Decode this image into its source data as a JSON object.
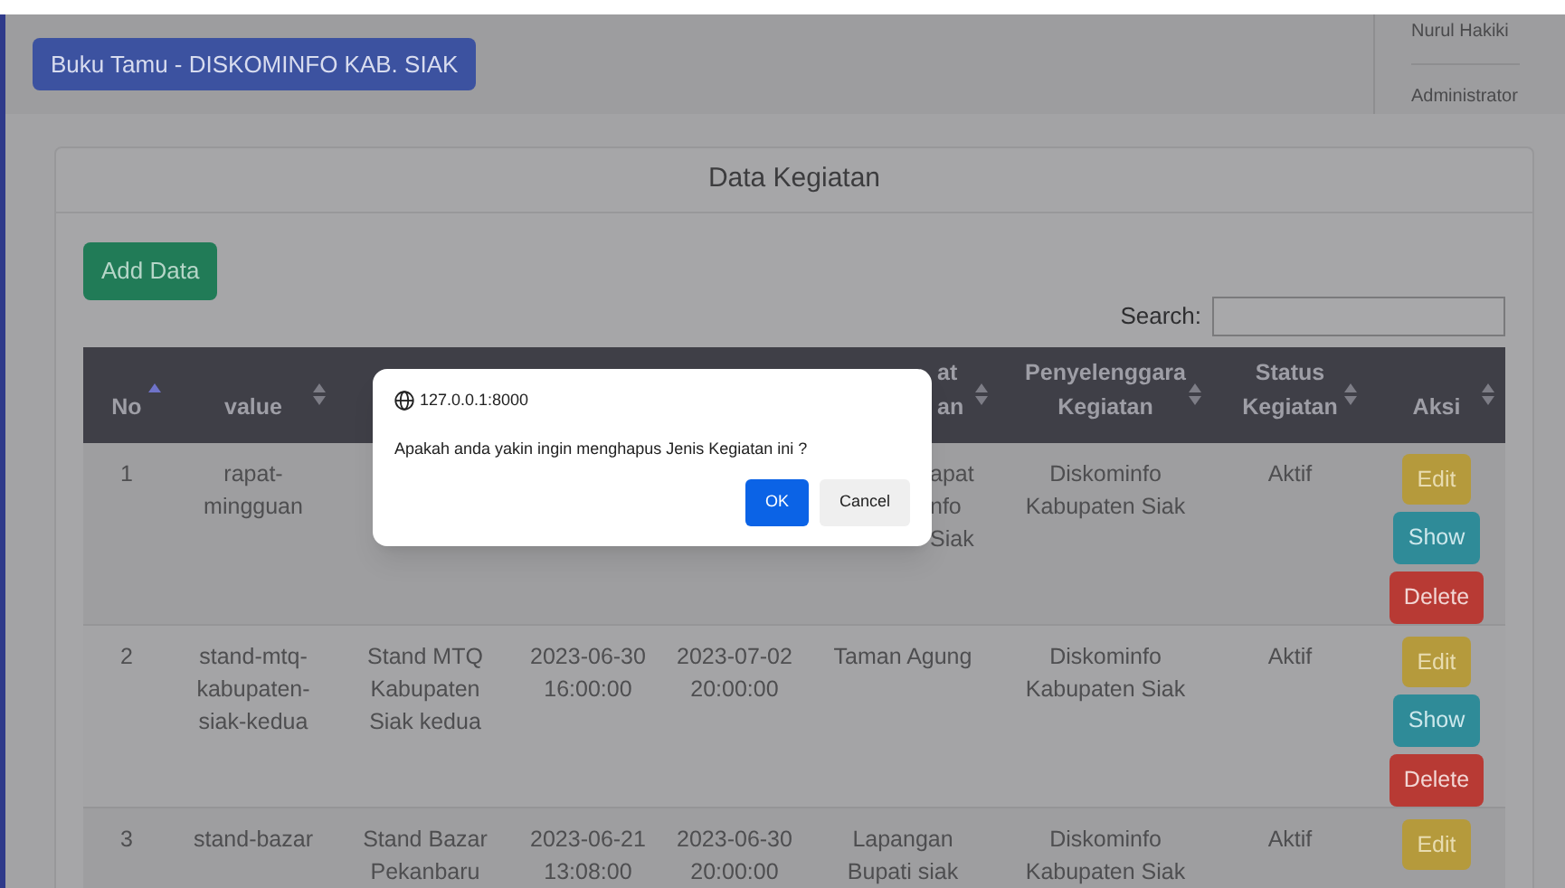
{
  "navbar": {
    "brand": "Buku Tamu - DISKOMINFO KAB. SIAK",
    "user_name": "Nurul Hakiki",
    "user_role": "Administrator"
  },
  "card": {
    "title": "Data Kegiatan",
    "add_button": "Add Data",
    "search_label": "Search:"
  },
  "table": {
    "columns": [
      {
        "label": "No",
        "sorted": true
      },
      {
        "label": "value",
        "sorted": false
      },
      {},
      {},
      {},
      {
        "label": "at an",
        "sorted": false
      },
      {
        "label": "Penyelenggara Kegiatan",
        "sorted": false
      },
      {
        "label": "Status Kegiatan",
        "sorted": false
      },
      {
        "label": "Aksi",
        "sorted": false
      }
    ],
    "rows": [
      {
        "cells": [
          "1",
          "rapat-mingguan",
          "",
          "",
          "",
          "apat nfo Siak",
          "Diskominfo Kabupaten Siak",
          "Aktif"
        ],
        "actions": [
          "Edit",
          "Show",
          "Delete"
        ]
      },
      {
        "cells": [
          "2",
          "stand-mtq-kabupaten-siak-kedua",
          "Stand MTQ Kabupaten Siak kedua",
          "2023-06-30 16:00:00",
          "2023-07-02 20:00:00",
          "Taman Agung",
          "Diskominfo Kabupaten Siak",
          "Aktif"
        ],
        "actions": [
          "Edit",
          "Show",
          "Delete"
        ]
      },
      {
        "cells": [
          "3",
          "stand-bazar",
          "Stand Bazar Pekanbaru",
          "2023-06-21 13:08:00",
          "2023-06-30 20:00:00",
          "Lapangan Bupati siak",
          "Diskominfo Kabupaten Siak",
          "Aktif"
        ],
        "actions": [
          "Edit"
        ]
      }
    ]
  },
  "dialog": {
    "origin": "127.0.0.1:8000",
    "message": "Apakah anda yakin ingin menghapus Jenis Kegiatan ini ?",
    "buttons": [
      {
        "label": "OK",
        "kind": "primary"
      },
      {
        "label": "Cancel",
        "kind": "secondary"
      }
    ]
  }
}
